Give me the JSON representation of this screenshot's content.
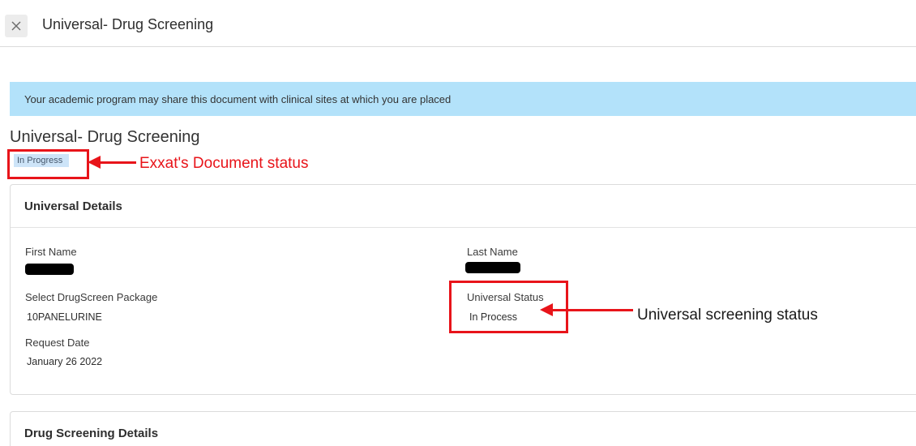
{
  "header": {
    "title": "Universal- Drug Screening"
  },
  "banner": {
    "text": "Your academic program may share this document with clinical sites at which you are placed"
  },
  "document": {
    "title": "Universal- Drug Screening",
    "status": "In Progress"
  },
  "universal_details": {
    "heading": "Universal Details",
    "first_name_label": "First Name",
    "last_name_label": "Last Name",
    "package_label": "Select DrugScreen Package",
    "package_value": "10PANELURINE",
    "universal_status_label": "Universal Status",
    "universal_status_value": "In Process",
    "request_date_label": "Request Date",
    "request_date_value": "January 26 2022"
  },
  "drug_screening_details": {
    "heading": "Drug Screening Details"
  },
  "annotations": {
    "document_status": "Exxat's Document status",
    "screening_status": "Universal screening status"
  },
  "colors": {
    "banner": "#b3e2fa",
    "status_chip": "#cde4f8",
    "annotation": "#e8141a"
  },
  "icons": {
    "close": "close-icon"
  }
}
